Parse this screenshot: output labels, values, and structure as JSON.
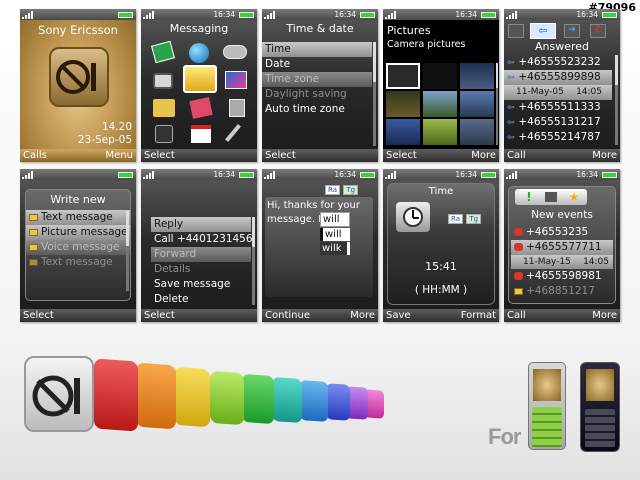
{
  "watermark": "#79096",
  "status": {
    "time": "16:34"
  },
  "s1": {
    "title": "Sony Ericsson",
    "time": "14.20",
    "date": "23-Sep-05",
    "left": "Calls",
    "right": "Menu"
  },
  "s2": {
    "title": "Messaging",
    "left": "Select",
    "icons": [
      "cards-icon",
      "globe-icon",
      "gamepad-icon",
      "camera-icon",
      "envelope-icon",
      "film-icon",
      "folder-icon",
      "notepad-icon",
      "phone-icon",
      "blackberry-icon",
      "calendar-icon",
      "wrench-icon"
    ]
  },
  "s3": {
    "title": "Time & date",
    "left": "Select",
    "items": [
      "Time",
      "Date",
      "Time zone",
      "Daylight saving",
      "Auto time zone"
    ]
  },
  "s4": {
    "title": "Pictures",
    "subtitle": "Camera pictures",
    "left": "Select",
    "right": "More"
  },
  "s5": {
    "title": "Answered",
    "left": "Call",
    "right": "More",
    "numbers": [
      "+46555523232",
      "+46555899898",
      "+46555511333",
      "+46555131217",
      "+46555214787"
    ],
    "date": "11-May-05",
    "time": "14:05"
  },
  "s6": {
    "title": "Write new",
    "left": "Select",
    "items": [
      "Text message",
      "Picture message",
      "Voice message",
      "Text message"
    ]
  },
  "s7": {
    "left": "Select",
    "items": [
      "Reply",
      "Call +4401231456",
      "Forward",
      "Details",
      "Save message",
      "Delete"
    ]
  },
  "s8": {
    "left": "Continue",
    "right": "More",
    "text": "Hi, thanks for your message. I",
    "suggestions": [
      "will",
      "will",
      "wilk"
    ],
    "mode1": "Ra",
    "mode2": "Tg"
  },
  "s9": {
    "title": "Time",
    "left": "Save",
    "right": "Format",
    "time": "15:41",
    "format": "( HH:MM )",
    "mode1": "Ra",
    "mode2": "Tg"
  },
  "s10": {
    "title": "New events",
    "left": "Call",
    "right": "More",
    "numbers": [
      "+46553235",
      "+4655577711",
      "+4655598981",
      "+468851217"
    ],
    "date": "11-May-15",
    "time": "14:05"
  },
  "promo": {
    "for_label": "For"
  },
  "colors": {
    "rainbow": [
      "#d8d8d8",
      "#e02a2a",
      "#f08a1c",
      "#f0c81c",
      "#9ad62c",
      "#3cc03c",
      "#20b8a8",
      "#2898e0",
      "#3858d8",
      "#a048d8",
      "#d848b8"
    ]
  }
}
